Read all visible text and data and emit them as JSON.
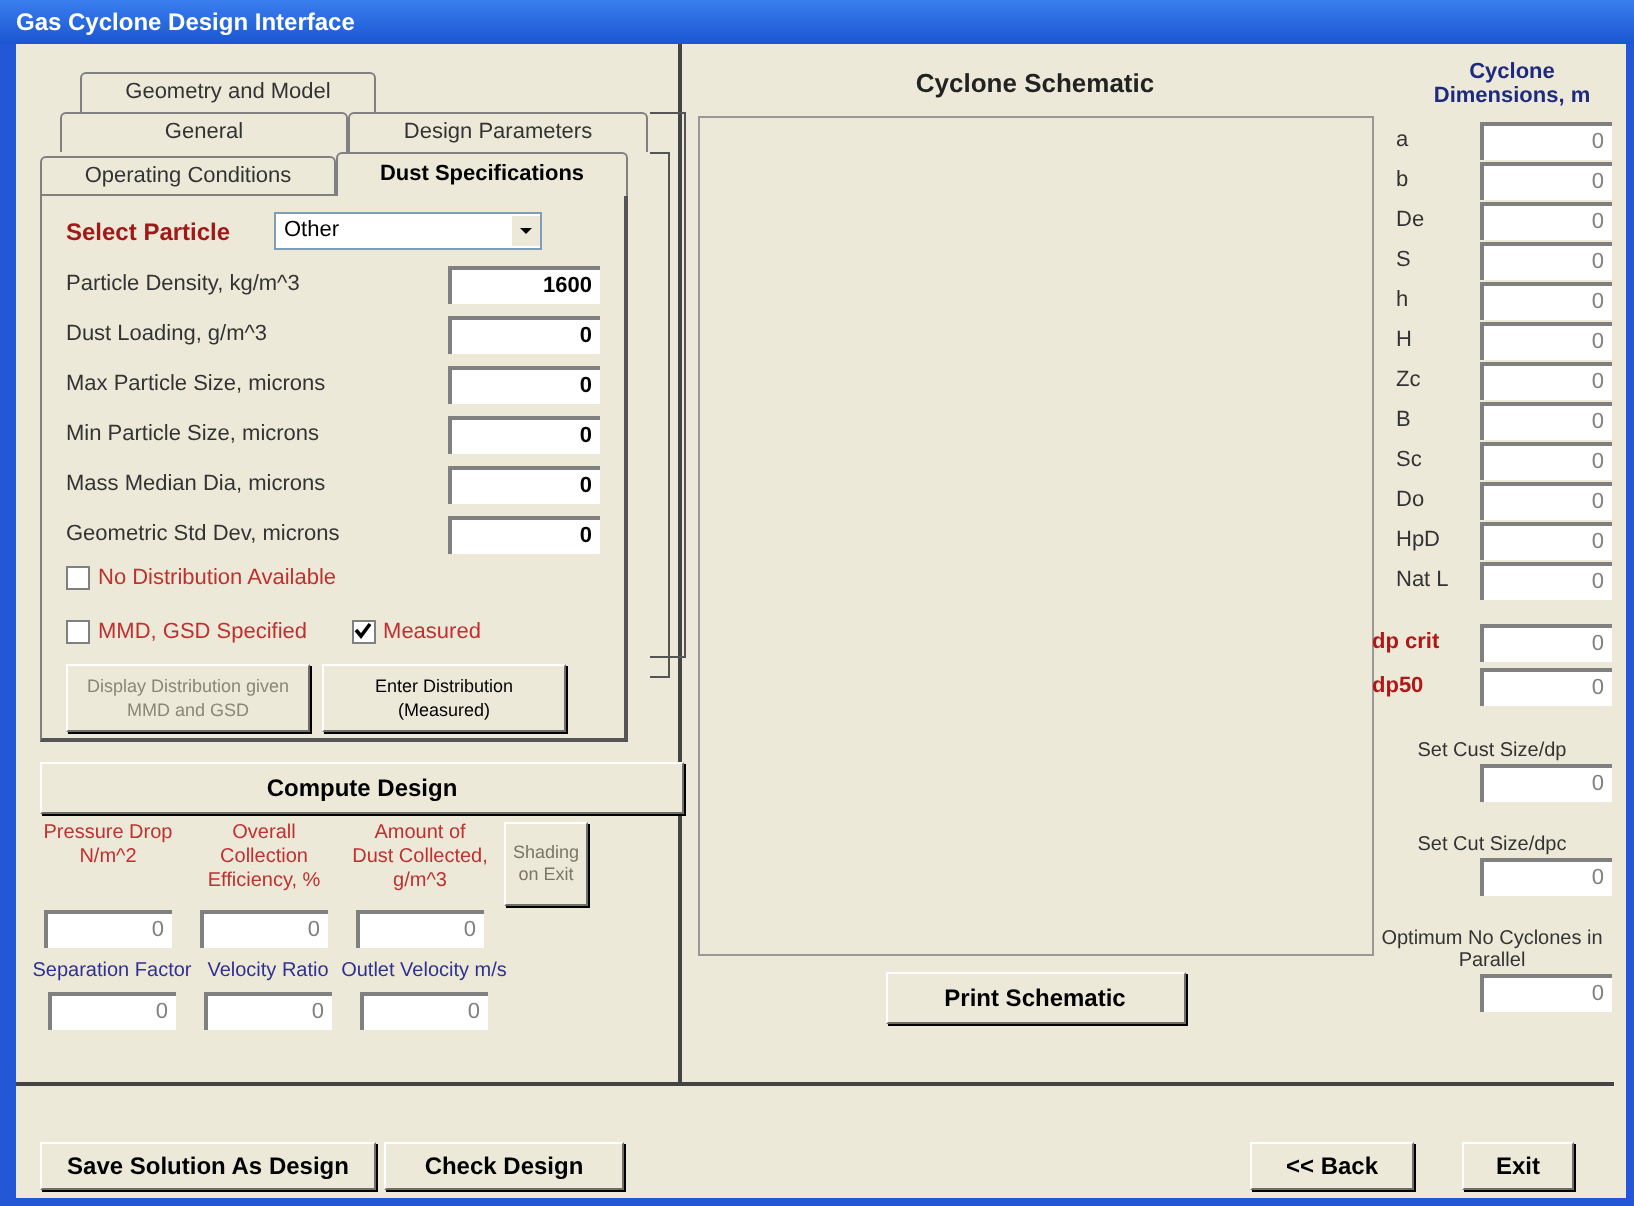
{
  "window": {
    "title": "Gas Cyclone Design Interface"
  },
  "tabs": [
    [
      {
        "label": "Geometry and Model",
        "selected": false
      }
    ],
    [
      {
        "label": "General",
        "selected": false
      },
      {
        "label": "Design Parameters",
        "selected": false
      }
    ],
    [
      {
        "label": "Operating Conditions",
        "selected": false
      },
      {
        "label": "Dust Specifications",
        "selected": true
      }
    ]
  ],
  "dust": {
    "select_label": "Select Particle",
    "select_value": "Other",
    "fields": [
      {
        "label": "Particle Density, kg/m^3",
        "value": "1600"
      },
      {
        "label": "Dust Loading, g/m^3",
        "value": "0"
      },
      {
        "label": "Max Particle Size, microns",
        "value": "0"
      },
      {
        "label": "Min Particle Size, microns",
        "value": "0"
      },
      {
        "label": "Mass Median Dia, microns",
        "value": "0"
      },
      {
        "label": "Geometric Std Dev, microns",
        "value": "0"
      }
    ],
    "checkboxes": [
      {
        "label": "No Distribution Available",
        "checked": false
      },
      {
        "label": "MMD, GSD Specified",
        "checked": false
      },
      {
        "label": "Measured",
        "checked": true
      }
    ],
    "buttons": [
      {
        "label": "Display Distribution given MMD and GSD",
        "disabled": true
      },
      {
        "label": "Enter Distribution (Measured)",
        "disabled": false
      }
    ]
  },
  "compute_button": "Compute Design",
  "results": {
    "row1": [
      {
        "label": "Pressure Drop N/m^2",
        "value": "0"
      },
      {
        "label": "Overall Collection Efficiency, %",
        "value": "0"
      },
      {
        "label": "Amount of Dust Collected, g/m^3",
        "value": "0"
      }
    ],
    "side_button": {
      "label": "Shading on Exit",
      "disabled": true
    },
    "row2": [
      {
        "label": "Separation Factor",
        "value": "0"
      },
      {
        "label": "Velocity Ratio",
        "value": "0"
      },
      {
        "label": "Outlet Velocity m/s",
        "value": "0"
      }
    ]
  },
  "schematic": {
    "title": "Cyclone Schematic",
    "print_button": "Print Schematic"
  },
  "dimensions": {
    "title": "Cyclone Dimensions, m",
    "rows": [
      {
        "label": "a",
        "value": "0"
      },
      {
        "label": "b",
        "value": "0"
      },
      {
        "label": "De",
        "value": "0"
      },
      {
        "label": "S",
        "value": "0"
      },
      {
        "label": "h",
        "value": "0"
      },
      {
        "label": "H",
        "value": "0"
      },
      {
        "label": "Zc",
        "value": "0"
      },
      {
        "label": "B",
        "value": "0"
      },
      {
        "label": "Sc",
        "value": "0"
      },
      {
        "label": "Do",
        "value": "0"
      },
      {
        "label": "HpD",
        "value": "0"
      },
      {
        "label": "Nat L",
        "value": "0"
      }
    ],
    "cut_rows": [
      {
        "label": "dp crit",
        "value": "0"
      },
      {
        "label": "dp50",
        "value": "0"
      }
    ],
    "stacked": [
      {
        "label": "Set Cust Size/dp",
        "value": "0"
      },
      {
        "label": "Set Cut Size/dpc",
        "value": "0"
      },
      {
        "label": "Optimum No Cyclones in Parallel",
        "value": "0"
      }
    ]
  },
  "footer": {
    "left": [
      "Save Solution As Design",
      "Check Design"
    ],
    "right": [
      "<< Back",
      "Exit"
    ]
  }
}
